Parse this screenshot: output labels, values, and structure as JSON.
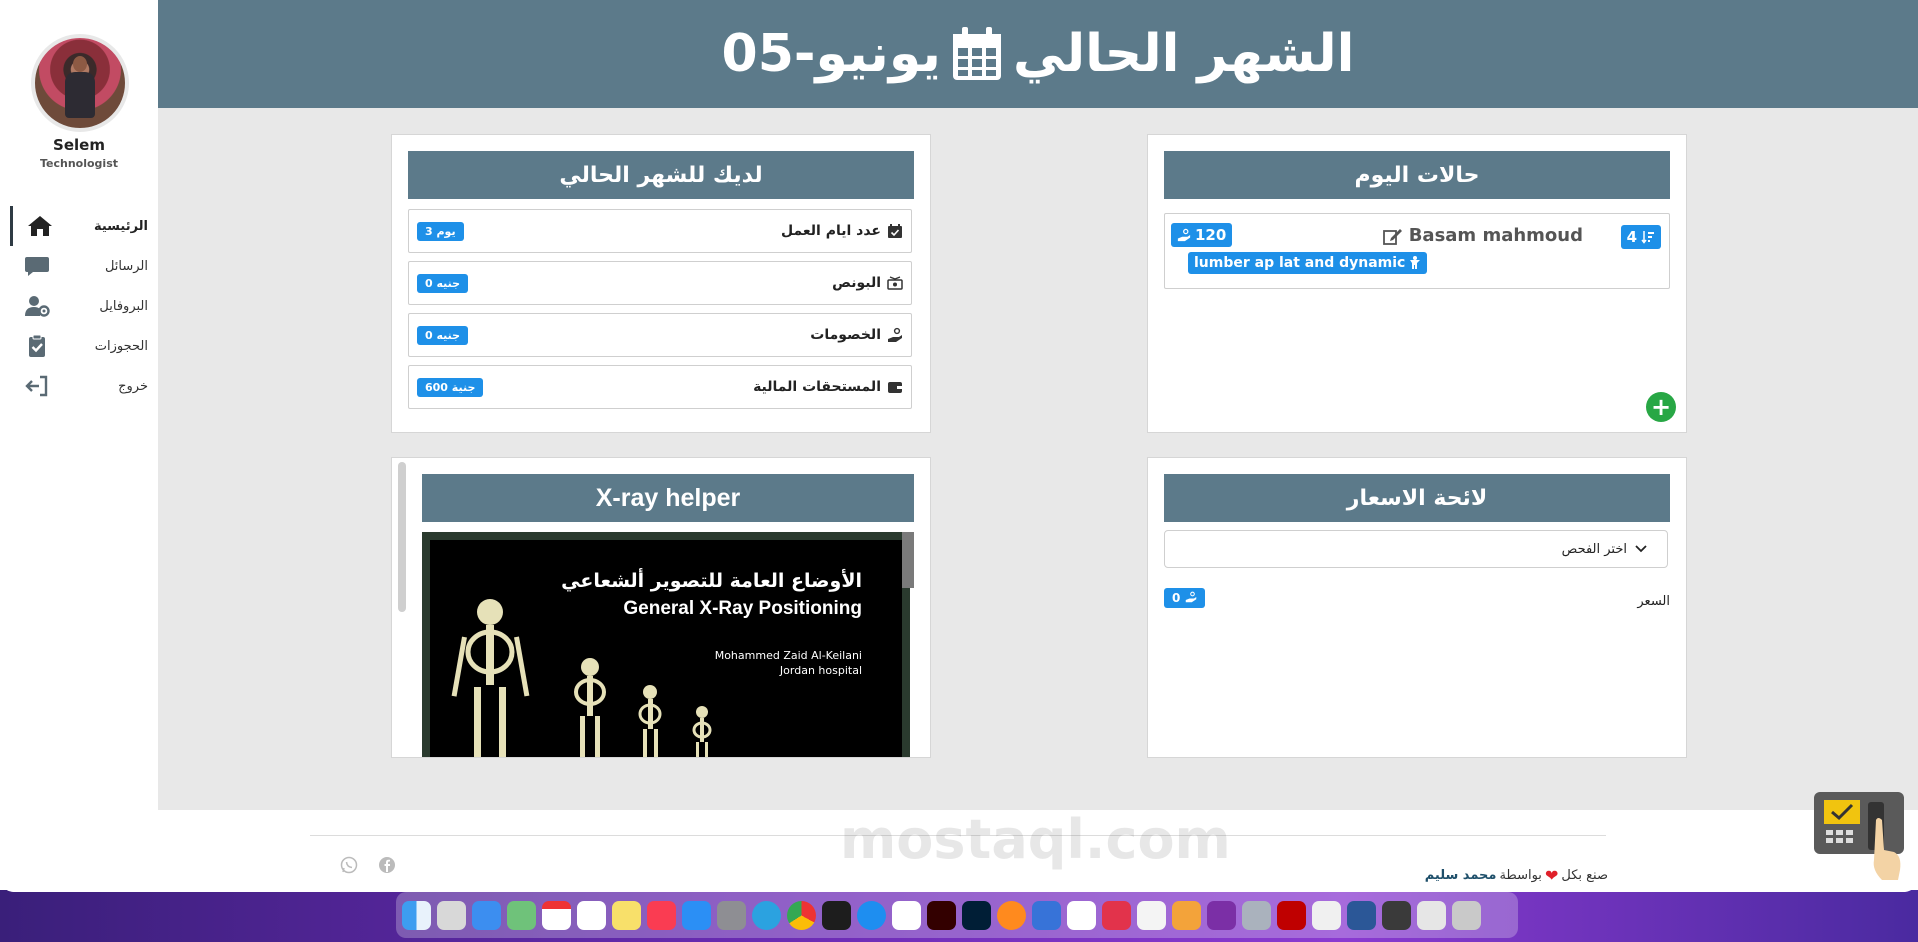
{
  "header": {
    "title": "الشهر الحالي",
    "month": "يونيو-05"
  },
  "user": {
    "name": "Selem",
    "role": "Technologist"
  },
  "nav": [
    {
      "label": "الرئيسية",
      "icon": "home-icon",
      "active": true
    },
    {
      "label": "الرسائل",
      "icon": "message-icon"
    },
    {
      "label": "البروفايل",
      "icon": "user-settings-icon"
    },
    {
      "label": "الحجوزات",
      "icon": "clipboard-check-icon"
    },
    {
      "label": "خروج",
      "icon": "logout-icon"
    }
  ],
  "month_card": {
    "title": "لديك للشهر الحالي",
    "rows": [
      {
        "label": "عدد ايام العمل",
        "value": "3 يوم",
        "icon": "calendar-check-icon"
      },
      {
        "label": "البونص",
        "value": "0 جنيه",
        "icon": "money-icon"
      },
      {
        "label": "الخصومات",
        "value": "0 جنيه",
        "icon": "hand-coin-icon"
      },
      {
        "label": "المستحقات المالية",
        "value": "600 جنية",
        "icon": "wallet-icon"
      }
    ]
  },
  "today_card": {
    "title": "حالات اليوم",
    "case": {
      "name": "Basam mahmoud",
      "count": "4",
      "price": "120",
      "exam": "lumber ap lat and dynamic"
    },
    "add_label": "+"
  },
  "prices_card": {
    "title": "لائحة الاسعار",
    "select_placeholder": "اختر الفحص",
    "price_label": "السعر",
    "price_value": "0"
  },
  "xray_card": {
    "title": "X-ray helper",
    "image_title_ar": "الأوضاع العامة للتصوير ألشعاعي",
    "image_title_en": "General X-Ray Positioning",
    "image_author": "Mohammed Zaid Al-Keilani",
    "image_hospital": "Jordan hospital"
  },
  "footer": {
    "made_with": "صنع بكل",
    "by": "بواسطة",
    "author": "محمد سليم"
  },
  "watermark": "mostaql.com",
  "colors": {
    "header": "#5c7a8a",
    "badge": "#1e90e8",
    "add": "#28a745"
  }
}
